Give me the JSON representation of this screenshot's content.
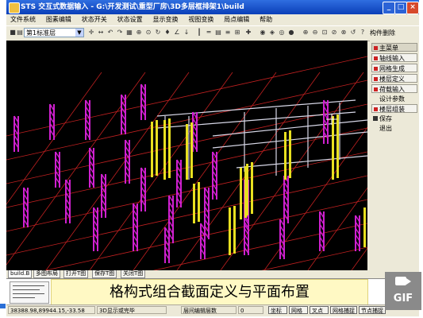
{
  "window": {
    "title": "STS 交互式数据输入 - G:\\开发测试\\重型厂房\\3D多层框排架1\\build",
    "buttons": {
      "minimize": "_",
      "maximize": "□",
      "close": "×"
    }
  },
  "menu": [
    "文件系统",
    "图素编辑",
    "状态开关",
    "状态设置",
    "显示变换",
    "视图变换",
    "局点编辑",
    "帮助"
  ],
  "toolbar": {
    "layer_select": "第1标准层",
    "right_button": "构件删除",
    "icons": [
      "save-icon",
      "print-icon",
      "zoom-icon",
      "grid-icon",
      "lamp-icon",
      "camera-icon",
      "dimension-icon",
      "axis-icon",
      "column-icon",
      "beam-icon",
      "3d-icon",
      "zoom-in-icon",
      "zoom-out-icon",
      "window-icon",
      "pan-icon",
      "refresh-icon",
      "help-icon"
    ]
  },
  "right_panel": {
    "items": [
      {
        "label": "主菜单",
        "type": "button",
        "selected": true
      },
      {
        "label": "轴线输入",
        "type": "button"
      },
      {
        "label": "网格生成",
        "type": "button"
      },
      {
        "label": "楼层定义",
        "type": "button"
      },
      {
        "label": "荷载输入",
        "type": "button"
      },
      {
        "label": "设计参数",
        "type": "plain"
      },
      {
        "label": "楼层组装",
        "type": "button"
      },
      {
        "label": "保存",
        "type": "plain-icon"
      },
      {
        "label": "退出",
        "type": "plain"
      }
    ]
  },
  "tabs": [
    "build.B",
    "多图布局",
    "打开T图",
    "保存T图",
    "关闭T图"
  ],
  "caption": "格构式组合截面定义与平面布置",
  "status": {
    "coords": "38388.98,89944.15,-33.58",
    "mode": "3D显示或完毕",
    "layer_info": "层间编辑层数",
    "layer_count": "0",
    "btn_coords": "坐标",
    "btn_grid": "网格",
    "btn_snap": "叉点",
    "btn_netcapture": "网格捕捉",
    "btn_nodecapture": "节点捕捉"
  },
  "gif_badge": "GIF",
  "colors": {
    "canvas_bg": "#000000",
    "grid_line": "#c02020",
    "column_yellow": "#e8e020",
    "lattice_magenta": "#d020d0",
    "frame_white": "#d8d8e8",
    "caption_bg": "#fff9c4"
  }
}
